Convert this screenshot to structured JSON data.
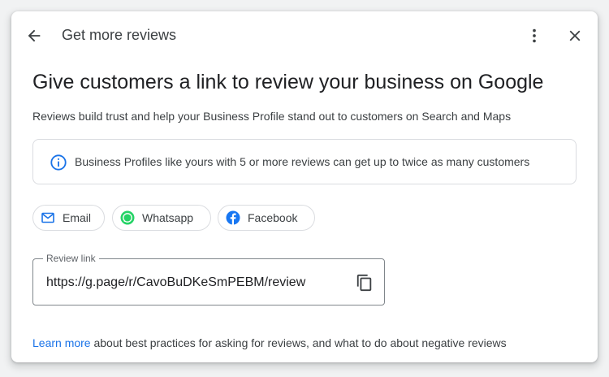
{
  "dialog": {
    "title": "Get more reviews",
    "heading": "Give customers a link to review your business on Google",
    "subtext": "Reviews build trust and help your Business Profile stand out to customers on Search and Maps",
    "info": "Business Profiles like yours with 5 or more reviews can get up to twice as many customers"
  },
  "share": {
    "email": "Email",
    "whatsapp": "Whatsapp",
    "facebook": "Facebook"
  },
  "review_link": {
    "label": "Review link",
    "value": "https://g.page/r/CavoBuDKeSmPEBM/review"
  },
  "footer": {
    "link": "Learn more",
    "text": " about best practices for asking for reviews, and what to do about negative reviews"
  },
  "colors": {
    "accent": "#1a73e8",
    "whatsapp": "#25d366",
    "facebook": "#1877f2"
  },
  "icons": [
    "back-arrow-icon",
    "more-vert-icon",
    "close-icon",
    "info-icon",
    "mail-icon",
    "whatsapp-icon",
    "facebook-icon",
    "copy-icon"
  ]
}
